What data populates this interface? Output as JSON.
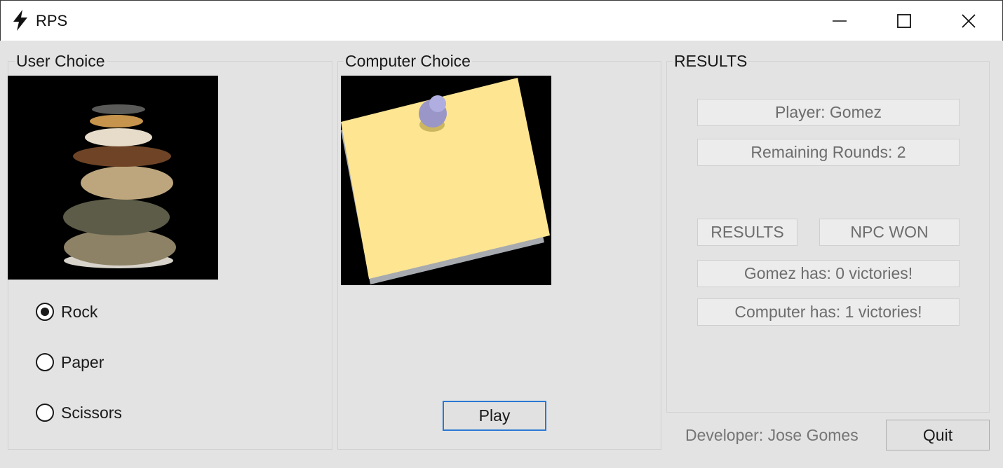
{
  "window": {
    "title": "RPS",
    "app_icon": "lightning-icon",
    "controls": {
      "minimize": "minimize-icon",
      "maximize": "maximize-icon",
      "close": "close-icon"
    }
  },
  "user_panel": {
    "label": "User Choice",
    "image": "rock-stones-image",
    "options": [
      {
        "label": "Rock",
        "checked": true
      },
      {
        "label": "Paper",
        "checked": false
      },
      {
        "label": "Scissors",
        "checked": false
      }
    ]
  },
  "computer_panel": {
    "label": "Computer Choice",
    "image": "paper-sticky-note-image",
    "play_label": "Play"
  },
  "results_panel": {
    "label": "RESULTS",
    "player": "Player: Gomez",
    "remaining_rounds": "Remaining Rounds: 2",
    "results_label": "RESULTS",
    "outcome": "NPC WON",
    "player_victories": "Gomez has: 0 victories!",
    "computer_victories": "Computer has: 1 victories!"
  },
  "footer": {
    "developer": "Developer: Jose Gomes",
    "quit_label": "Quit"
  },
  "colors": {
    "background": "#e3e3e3",
    "focus_border": "#2a78d4",
    "disabled_text": "#6d6d6d"
  }
}
